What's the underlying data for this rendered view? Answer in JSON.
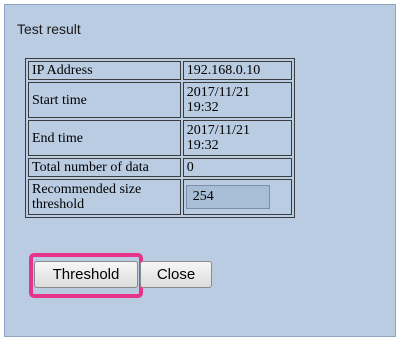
{
  "dialog": {
    "title": "Test result"
  },
  "table": {
    "rows": [
      {
        "label": "IP Address",
        "value": "192.168.0.10"
      },
      {
        "label": "Start time",
        "value": "2017/11/21\n19:32"
      },
      {
        "label": "End time",
        "value": "2017/11/21\n19:32"
      },
      {
        "label": "Total number of data",
        "value": "0"
      },
      {
        "label": "Recommended size threshold",
        "value": "254"
      }
    ]
  },
  "buttons": {
    "threshold_label": "Threshold",
    "close_label": "Close"
  },
  "colors": {
    "dialog_bg": "#b9cce2",
    "highlight": "#e8338a"
  }
}
